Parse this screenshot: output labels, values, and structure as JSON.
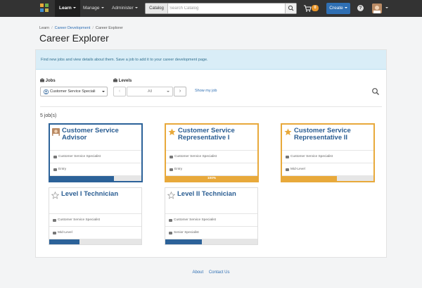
{
  "nav": {
    "learn": "Learn",
    "manage": "Manage",
    "administer": "Administer",
    "search_scope": "Catalog",
    "search_placeholder": "Search Catalog",
    "cart_count": "0",
    "create": "Create",
    "help": "?"
  },
  "breadcrumb": [
    "Learn",
    "Career Development",
    "Career Explorer"
  ],
  "page_title": "Career Explorer",
  "info": "Find new jobs and view details about them. Save a job to add it to your career development page.",
  "filters": {
    "jobs_label": "Jobs",
    "jobs_value": "Customer Service Speciali",
    "levels_label": "Levels",
    "levels_value": "All",
    "prev": "‹",
    "next": "›",
    "show_my_job": "Show my job"
  },
  "count": "5 job(s)",
  "cards": [
    {
      "title": "Customer Service Advisor",
      "family": "Customer Service Specialist",
      "level": "Entry",
      "progress": 0.7,
      "progress_label": "",
      "state": "selected",
      "icon": "user-avatar-icon"
    },
    {
      "title": "Customer Service Representative I",
      "family": "Customer Service Specialist",
      "level": "Entry",
      "progress": 1.0,
      "progress_label": "100%",
      "state": "saved",
      "icon": "star-filled-icon"
    },
    {
      "title": "Customer Service Representative II",
      "family": "Customer Service Specialist",
      "level": "Mid-Level",
      "progress": 0.6,
      "progress_label": "",
      "state": "saved",
      "icon": "star-filled-icon"
    },
    {
      "title": "Level I Technician",
      "family": "Customer Service Specialist",
      "level": "Mid-Level",
      "progress": 0.33,
      "progress_label": "",
      "state": "normal",
      "icon": "star-outline-icon"
    },
    {
      "title": "Level II Technician",
      "family": "Customer Service Specialist",
      "level": "Senior Specialist",
      "progress": 0.4,
      "progress_label": "",
      "state": "normal",
      "icon": "star-outline-icon"
    }
  ],
  "footer": {
    "about": "About",
    "contact": "Contact Us"
  },
  "colors": {
    "accent": "#2c6299",
    "saved": "#e8a93b",
    "info_bg": "#d9edf7"
  }
}
